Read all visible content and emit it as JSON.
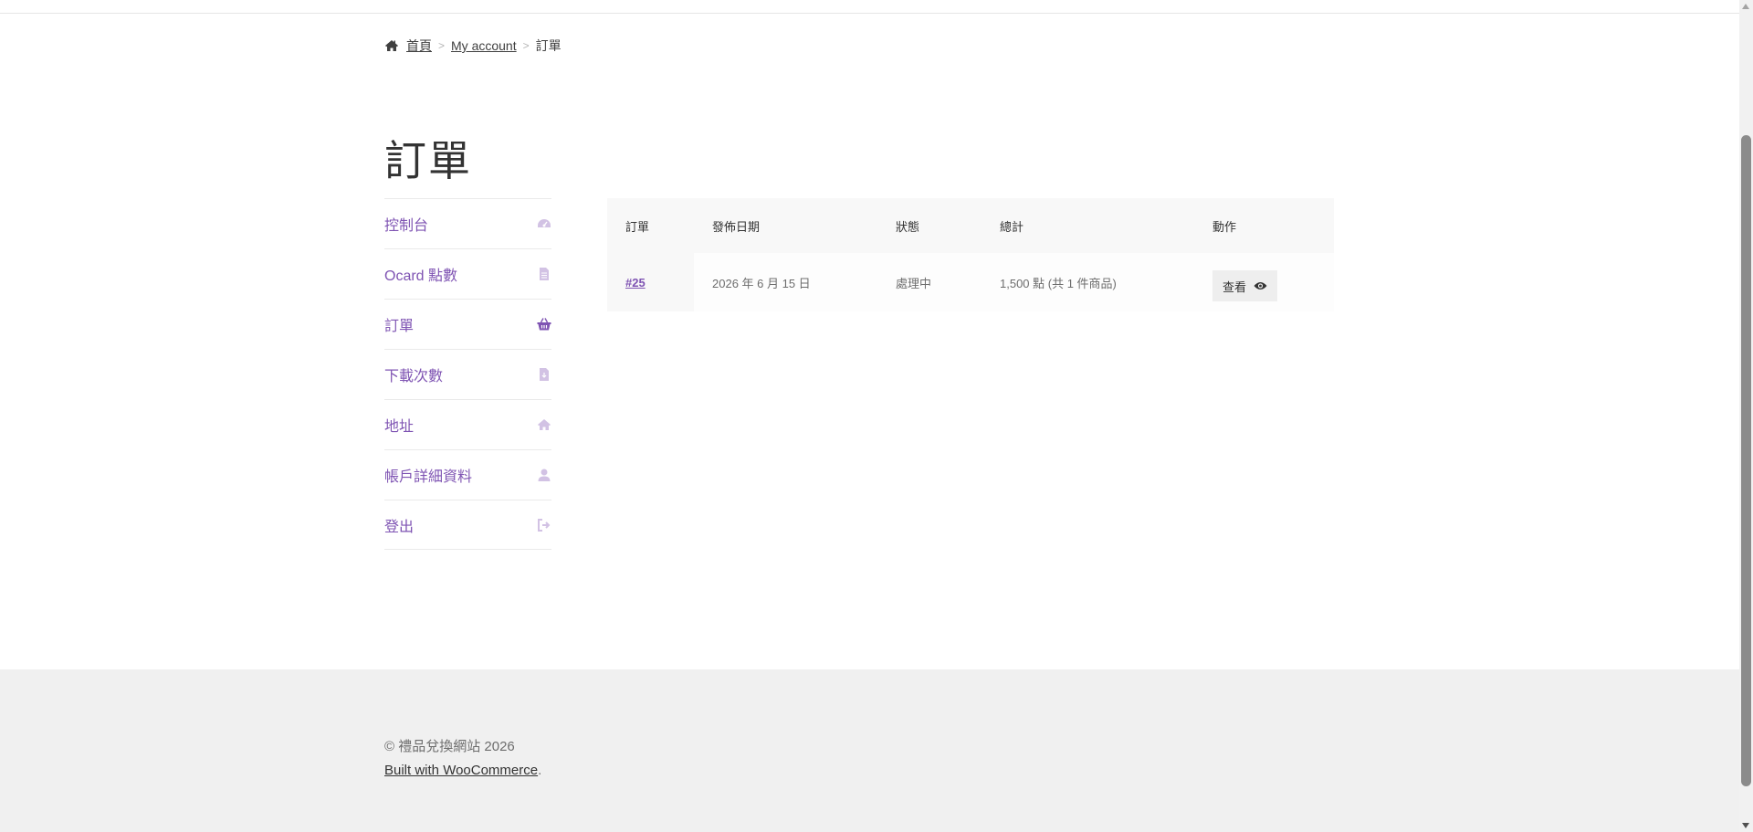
{
  "breadcrumb": {
    "home": "首頁",
    "separator": ">",
    "account": "My account",
    "current": "訂單"
  },
  "page": {
    "title": "訂單"
  },
  "nav": {
    "items": [
      {
        "label": "控制台",
        "icon": "dashboard-icon"
      },
      {
        "label": "Ocard 點數",
        "icon": "document-icon"
      },
      {
        "label": "訂單",
        "icon": "basket-icon",
        "active": true
      },
      {
        "label": "下載次數",
        "icon": "file-download-icon"
      },
      {
        "label": "地址",
        "icon": "home-icon"
      },
      {
        "label": "帳戶詳細資料",
        "icon": "user-icon"
      },
      {
        "label": "登出",
        "icon": "sign-out-icon"
      }
    ]
  },
  "orders": {
    "headers": {
      "order": "訂單",
      "date": "發佈日期",
      "status": "狀態",
      "total": "總計",
      "actions": "動作"
    },
    "rows": [
      {
        "number": "#25",
        "date": "2026 年 6 月 15 日",
        "status": "處理中",
        "total": "1,500 點 (共 1 件商品)",
        "action": "查看"
      }
    ]
  },
  "footer": {
    "copyright": "© 禮品兌換網站 2026",
    "built_with": "Built with WooCommerce",
    "period": "."
  },
  "colors": {
    "accent": "#7f54b3",
    "footer_bg": "#f0f0f0"
  }
}
